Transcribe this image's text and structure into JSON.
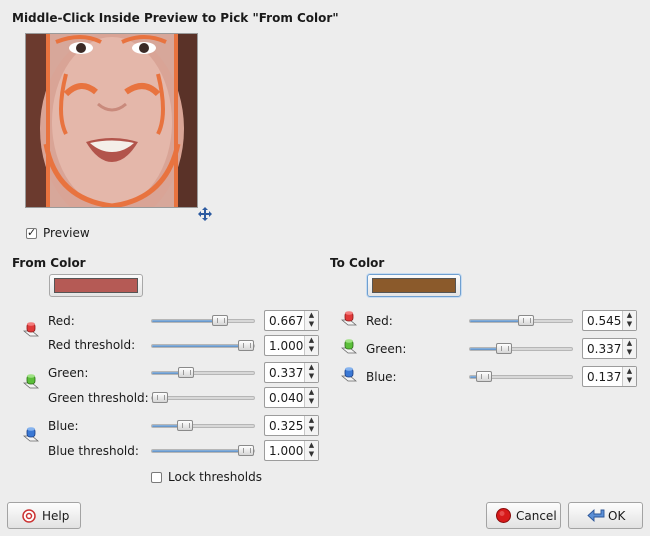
{
  "dialog": {
    "title": "Middle-Click Inside Preview to Pick \"From Color\"",
    "preview_label": "Preview",
    "preview_checked": true
  },
  "from_color": {
    "heading": "From Color",
    "swatch": "#b55a55",
    "rows": {
      "red": {
        "label": "Red:",
        "value": "0.667",
        "level": 0.667
      },
      "red_threshold": {
        "label": "Red threshold:",
        "value": "1.000",
        "level": 1.0
      },
      "green": {
        "label": "Green:",
        "value": "0.337",
        "level": 0.337
      },
      "green_threshold": {
        "label": "Green threshold:",
        "value": "0.040",
        "level": 0.04
      },
      "blue": {
        "label": "Blue:",
        "value": "0.325",
        "level": 0.325
      },
      "blue_threshold": {
        "label": "Blue threshold:",
        "value": "1.000",
        "level": 1.0
      }
    },
    "lock_thresholds_label": "Lock thresholds",
    "lock_thresholds_checked": false
  },
  "to_color": {
    "heading": "To Color",
    "swatch": "#8b5a2b",
    "rows": {
      "red": {
        "label": "Red:",
        "value": "0.545",
        "level": 0.545
      },
      "green": {
        "label": "Green:",
        "value": "0.337",
        "level": 0.337
      },
      "blue": {
        "label": "Blue:",
        "value": "0.137",
        "level": 0.137
      }
    }
  },
  "buttons": {
    "help": "Help",
    "cancel": "Cancel",
    "ok": "OK"
  },
  "icons": {
    "move": "move-arrows-icon",
    "red_channel": "red-channel-icon",
    "green_channel": "green-channel-icon",
    "blue_channel": "blue-channel-icon",
    "help": "help-icon",
    "cancel": "cancel-icon",
    "ok": "ok-icon"
  }
}
